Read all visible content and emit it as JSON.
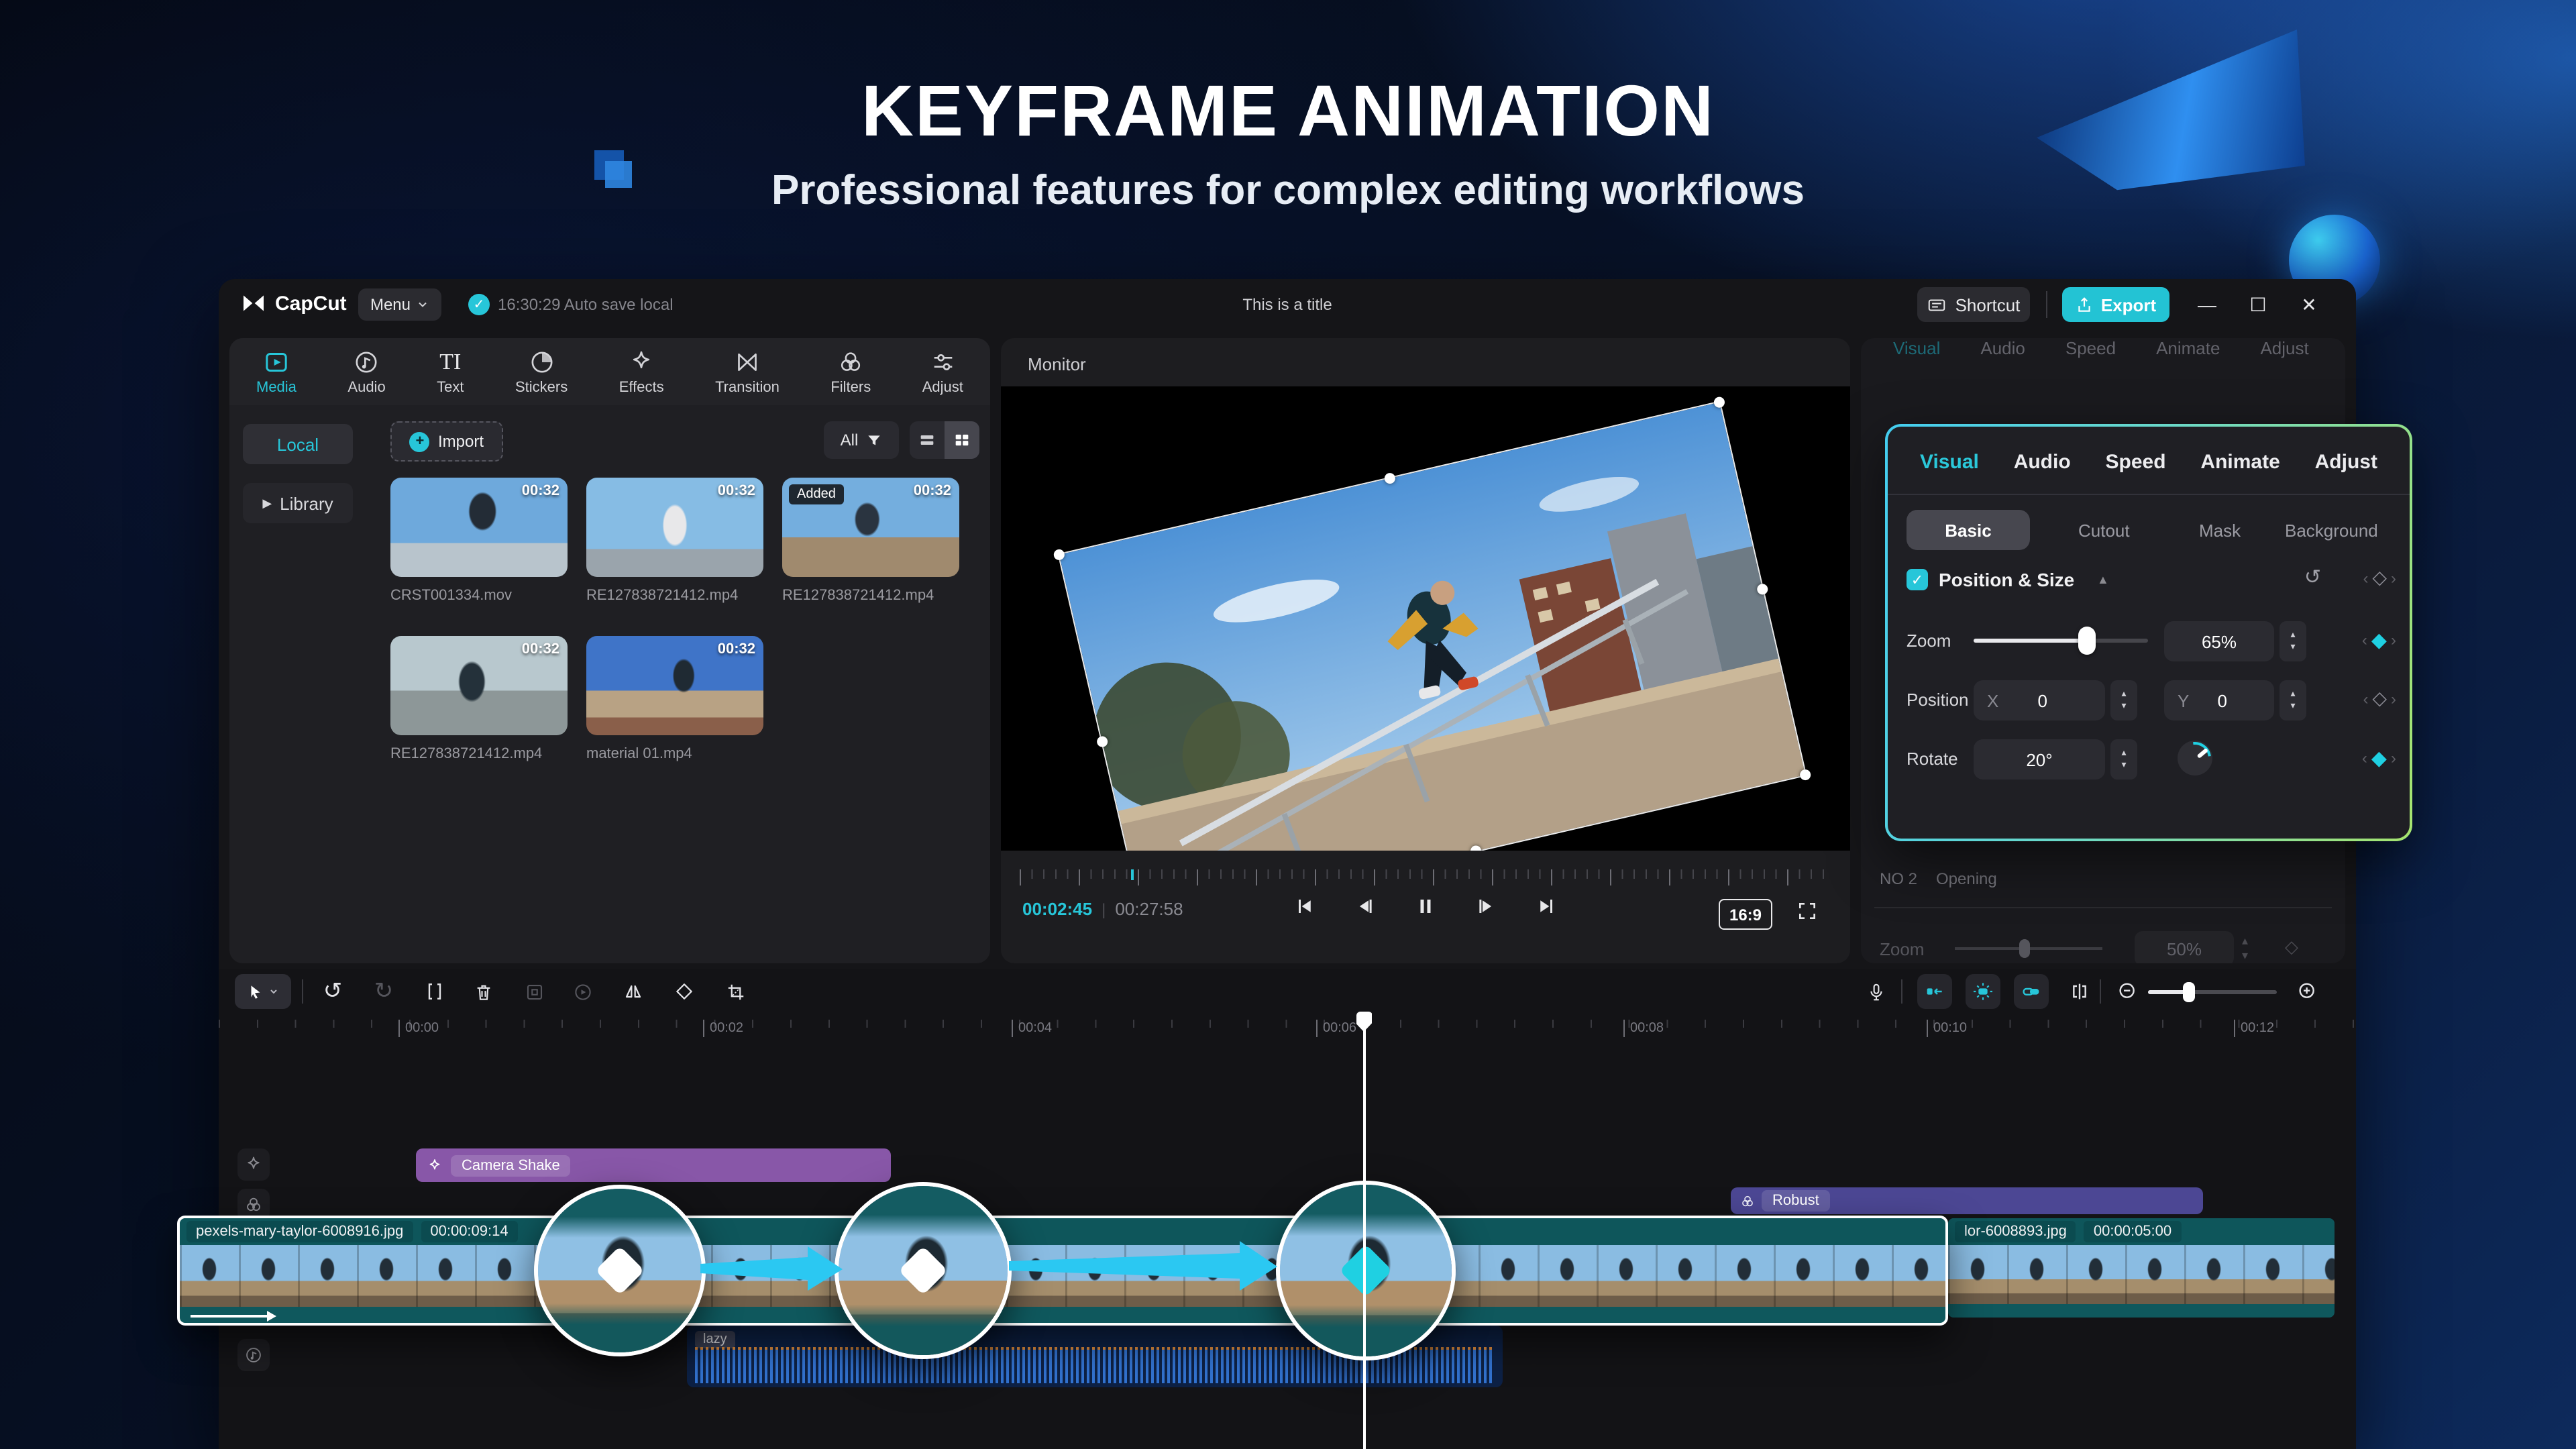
{
  "hero": {
    "title": "KEYFRAME ANIMATION",
    "subtitle": "Professional features for complex editing workflows"
  },
  "titlebar": {
    "app_name": "CapCut",
    "menu": "Menu",
    "autosave": "16:30:29 Auto save local",
    "window_title": "This is a title",
    "shortcut": "Shortcut",
    "export": "Export",
    "minimize": "—",
    "maximize": "☐",
    "close": "✕"
  },
  "media_panel": {
    "tabs": [
      {
        "label": "Media"
      },
      {
        "label": "Audio"
      },
      {
        "label": "Text"
      },
      {
        "label": "Stickers"
      },
      {
        "label": "Effects"
      },
      {
        "label": "Transition"
      },
      {
        "label": "Filters"
      },
      {
        "label": "Adjust"
      }
    ],
    "sources": {
      "local": "Local",
      "library": "Library"
    },
    "import_label": "Import",
    "filter_all": "All",
    "items": [
      {
        "name": "CRST001334.mov",
        "duration": "00:32"
      },
      {
        "name": "RE127838721412.mp4",
        "duration": "00:32"
      },
      {
        "name": "RE127838721412.mp4",
        "duration": "00:32",
        "badge": "Added"
      },
      {
        "name": "RE127838721412.mp4",
        "duration": "00:32"
      },
      {
        "name": "material 01.mp4",
        "duration": "00:32"
      }
    ]
  },
  "monitor": {
    "header": "Monitor",
    "current_time": "00:02:45",
    "total_time": "00:27:58",
    "aspect_ratio": "16:9"
  },
  "props": {
    "bg_tabs": [
      "Visual",
      "Audio",
      "Speed",
      "Animate",
      "Adjust"
    ],
    "card_tabs": [
      "Visual",
      "Audio",
      "Speed",
      "Animate",
      "Adjust"
    ],
    "sub_tabs": [
      "Basic",
      "Cutout",
      "Mask",
      "Background"
    ],
    "section_title": "Position & Size",
    "zoom_label": "Zoom",
    "zoom_value": "65%",
    "position_label": "Position",
    "x_label": "X",
    "x_value": "0",
    "y_label": "Y",
    "y_value": "0",
    "rotate_label": "Rotate",
    "rotate_value": "20°",
    "below": {
      "no": "NO 2",
      "name": "Opening",
      "dim_zoom_label": "Zoom",
      "dim_zoom_value": "50%"
    }
  },
  "timeline": {
    "ruler": [
      "00:00",
      "00:02",
      "00:04",
      "00:06",
      "00:08",
      "00:10",
      "00:12"
    ],
    "effect_clip": "Camera Shake",
    "filter_clip": "Robust",
    "clip1": {
      "name": "pexels-mary-taylor-6008916.jpg",
      "duration": "00:00:09:14"
    },
    "clip2": {
      "name": "lor-6008893.jpg",
      "duration": "00:00:05:00"
    },
    "audio_clip": "lazy"
  },
  "colors": {
    "accent_teal": "#27c6d9",
    "export_bg": "#23c3d4",
    "effect_purple": "#8857a8",
    "filter_indigo": "#4c4794",
    "clip_teal": "#0f585d",
    "audio_navy": "#0d2145",
    "keyframe_teal": "#1fd0e2",
    "arrow_cyan": "#2bc8f2"
  }
}
